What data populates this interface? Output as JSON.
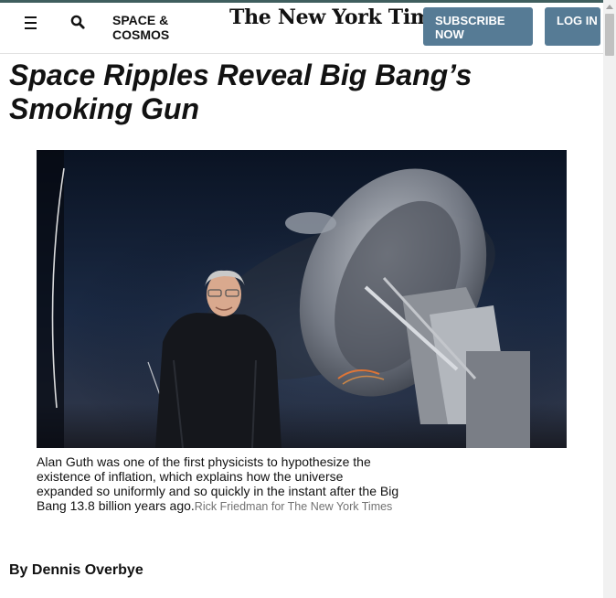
{
  "header": {
    "section_label": "SPACE & COSMOS",
    "logo_text": "The New York Times",
    "subscribe_label": "SUBSCRIBE NOW",
    "login_label": "LOG IN",
    "menu_icon": "hamburger-menu-icon",
    "search_icon": "search-icon"
  },
  "article": {
    "headline": "Space Ripples Reveal Big Bang’s Smoking Gun",
    "caption": "Alan Guth was one of the first physicists to hypothesize the existence of inflation, which explains how the universe expanded so uniformly and so quickly in the instant after the Big Bang 13.8 billion years ago.",
    "credit": "Rick Friedman for The New York Times",
    "byline": "By Dennis Overbye"
  },
  "colors": {
    "accent_button": "#567b95",
    "top_rule": "#3f5e5e",
    "credit_gray": "#727272"
  }
}
